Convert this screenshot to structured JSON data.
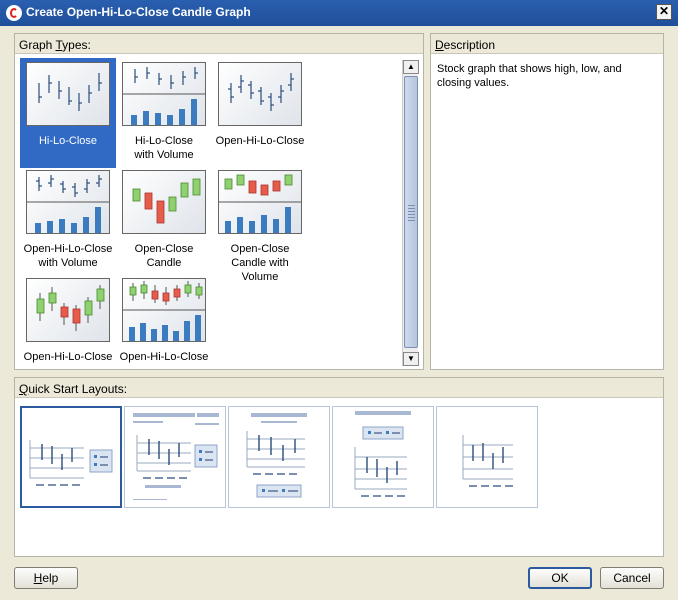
{
  "window": {
    "title": "Create Open-Hi-Lo-Close Candle Graph"
  },
  "graph_types": {
    "heading_pre": "Graph ",
    "heading_key": "T",
    "heading_post": "ypes:",
    "items": [
      {
        "line1": "Hi-Lo-Close",
        "line2": "",
        "selected": true
      },
      {
        "line1": "Hi-Lo-Close",
        "line2": "with Volume"
      },
      {
        "line1": "Open-Hi-Lo-Close",
        "line2": ""
      },
      {
        "line1": "Open-Hi-Lo-Close",
        "line2": "with Volume"
      },
      {
        "line1": "Open-Close Candle",
        "line2": ""
      },
      {
        "line1": "Open-Close",
        "line2": "Candle with Volume"
      },
      {
        "line1": "Open-Hi-Lo-Close",
        "line2": ""
      },
      {
        "line1": "Open-Hi-Lo-Close",
        "line2": ""
      }
    ]
  },
  "description": {
    "heading_pre": "",
    "heading_key": "D",
    "heading_post": "escription",
    "line1": "Stock graph that shows high, low, and",
    "line2": "closing values."
  },
  "quick_start": {
    "heading_pre": "",
    "heading_key": "Q",
    "heading_post": "uick Start Layouts:"
  },
  "buttons": {
    "help_key": "H",
    "help_rest": "elp",
    "ok": "OK",
    "cancel": "Cancel"
  },
  "colors": {
    "selection": "#316ac5",
    "bar": "#3a7cbf",
    "candle_up": "#8fd16f",
    "candle_down": "#e55d4a",
    "stick": "#2b4d7a"
  }
}
